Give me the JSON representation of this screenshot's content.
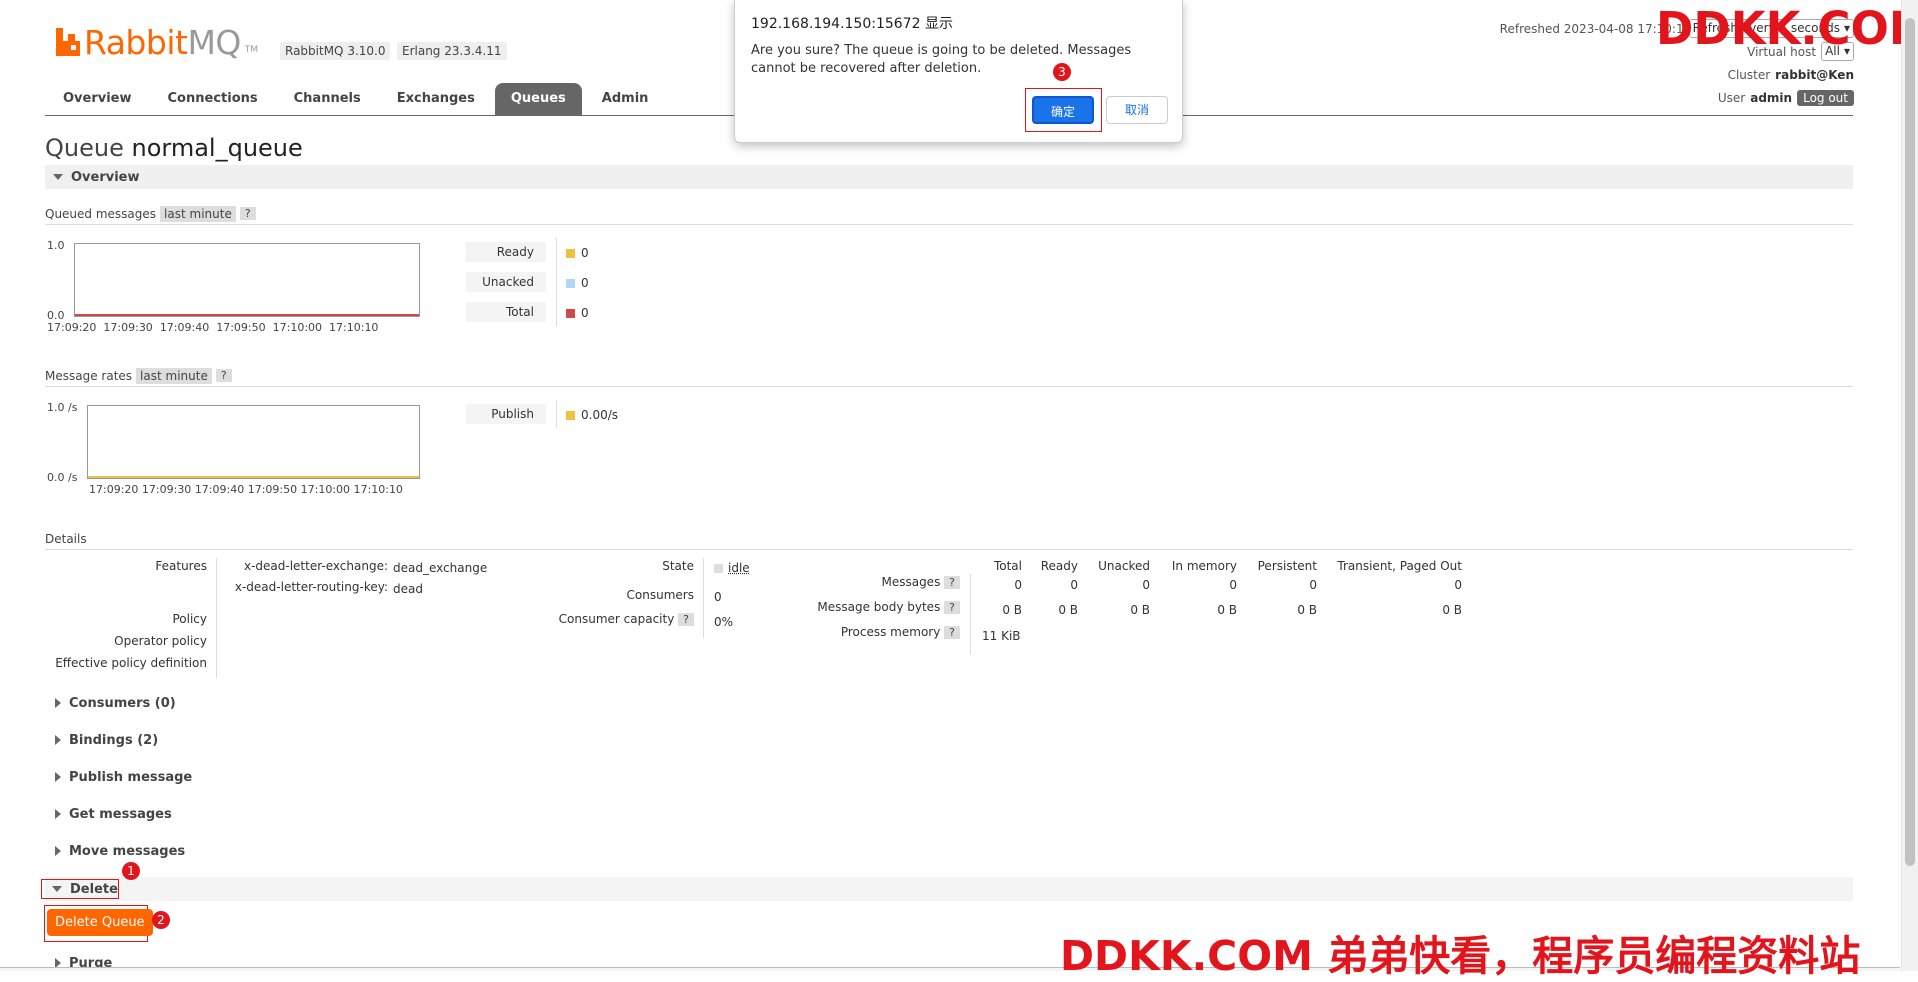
{
  "header": {
    "logo_text_a": "Rabbit",
    "logo_text_b": "MQ",
    "logo_tm": "TM",
    "version": "RabbitMQ 3.10.0",
    "erlang": "Erlang 23.3.4.11",
    "refreshed": "Refreshed 2023-04-08 17:10:1",
    "refresh_select": "Refresh every 5 seconds",
    "vhost_label": "Virtual host",
    "vhost_value": "All",
    "cluster_label": "Cluster",
    "cluster_value": "rabbit@Ken",
    "user_label": "User",
    "user_value": "admin",
    "logout": "Log out"
  },
  "nav": {
    "tabs": [
      "Overview",
      "Connections",
      "Channels",
      "Exchanges",
      "Queues",
      "Admin"
    ],
    "active": "Queues"
  },
  "page": {
    "title_prefix": "Queue",
    "title_name": "normal_queue",
    "overview_section": "Overview"
  },
  "queued_messages": {
    "label": "Queued messages",
    "range": "last minute",
    "help": "?",
    "y_top": "1.0",
    "y_bottom": "0.0",
    "x_ticks": [
      "17:09:20",
      "17:09:30",
      "17:09:40",
      "17:09:50",
      "17:10:00",
      "17:10:10"
    ],
    "legend": [
      {
        "label": "Ready",
        "value": "0",
        "color": "#edc240"
      },
      {
        "label": "Unacked",
        "value": "0",
        "color": "#afd8f8"
      },
      {
        "label": "Total",
        "value": "0",
        "color": "#cb4b4b"
      }
    ]
  },
  "message_rates": {
    "label": "Message rates",
    "range": "last minute",
    "help": "?",
    "y_top": "1.0 /s",
    "y_bottom": "0.0 /s",
    "x_ticks": [
      "17:09:20",
      "17:09:30",
      "17:09:40",
      "17:09:50",
      "17:10:00",
      "17:10:10"
    ],
    "legend": [
      {
        "label": "Publish",
        "value": "0.00/s",
        "color": "#edc240"
      }
    ]
  },
  "details": {
    "label": "Details",
    "features_label": "Features",
    "features": [
      {
        "key": "x-dead-letter-exchange:",
        "value": "dead_exchange"
      },
      {
        "key": "x-dead-letter-routing-key:",
        "value": "dead"
      }
    ],
    "policy_label": "Policy",
    "operator_policy_label": "Operator policy",
    "effective_policy_label": "Effective policy definition",
    "state_label": "State",
    "state_value": "idle",
    "consumers_label": "Consumers",
    "consumers_value": "0",
    "capacity_label": "Consumer capacity",
    "capacity_help": "?",
    "capacity_value": "0%",
    "stats_headers": [
      "Total",
      "Ready",
      "Unacked",
      "In memory",
      "Persistent",
      "Transient, Paged Out"
    ],
    "messages_label": "Messages",
    "messages_values": [
      "0",
      "0",
      "0",
      "0",
      "0",
      "0"
    ],
    "body_bytes_label": "Message body bytes",
    "body_bytes_values": [
      "0 B",
      "0 B",
      "0 B",
      "0 B",
      "0 B",
      "0 B"
    ],
    "process_memory_label": "Process memory",
    "process_memory_value": "11 KiB",
    "help": "?"
  },
  "collapsed_sections": [
    "Consumers (0)",
    "Bindings (2)",
    "Publish message",
    "Get messages",
    "Move messages"
  ],
  "delete_section": {
    "label": "Delete",
    "button": "Delete Queue",
    "badge1": "1",
    "badge2": "2"
  },
  "purge_section": "Purge",
  "dialog": {
    "title": "192.168.194.150:15672 显示",
    "message": "Are you sure? The queue is going to be deleted. Messages cannot be recovered after deletion.",
    "ok": "确定",
    "cancel": "取消",
    "badge3": "3"
  },
  "watermarks": {
    "top": "DDKK.COM",
    "bottom": "DDKK.COM 弟弟快看，程序员编程资料站"
  }
}
